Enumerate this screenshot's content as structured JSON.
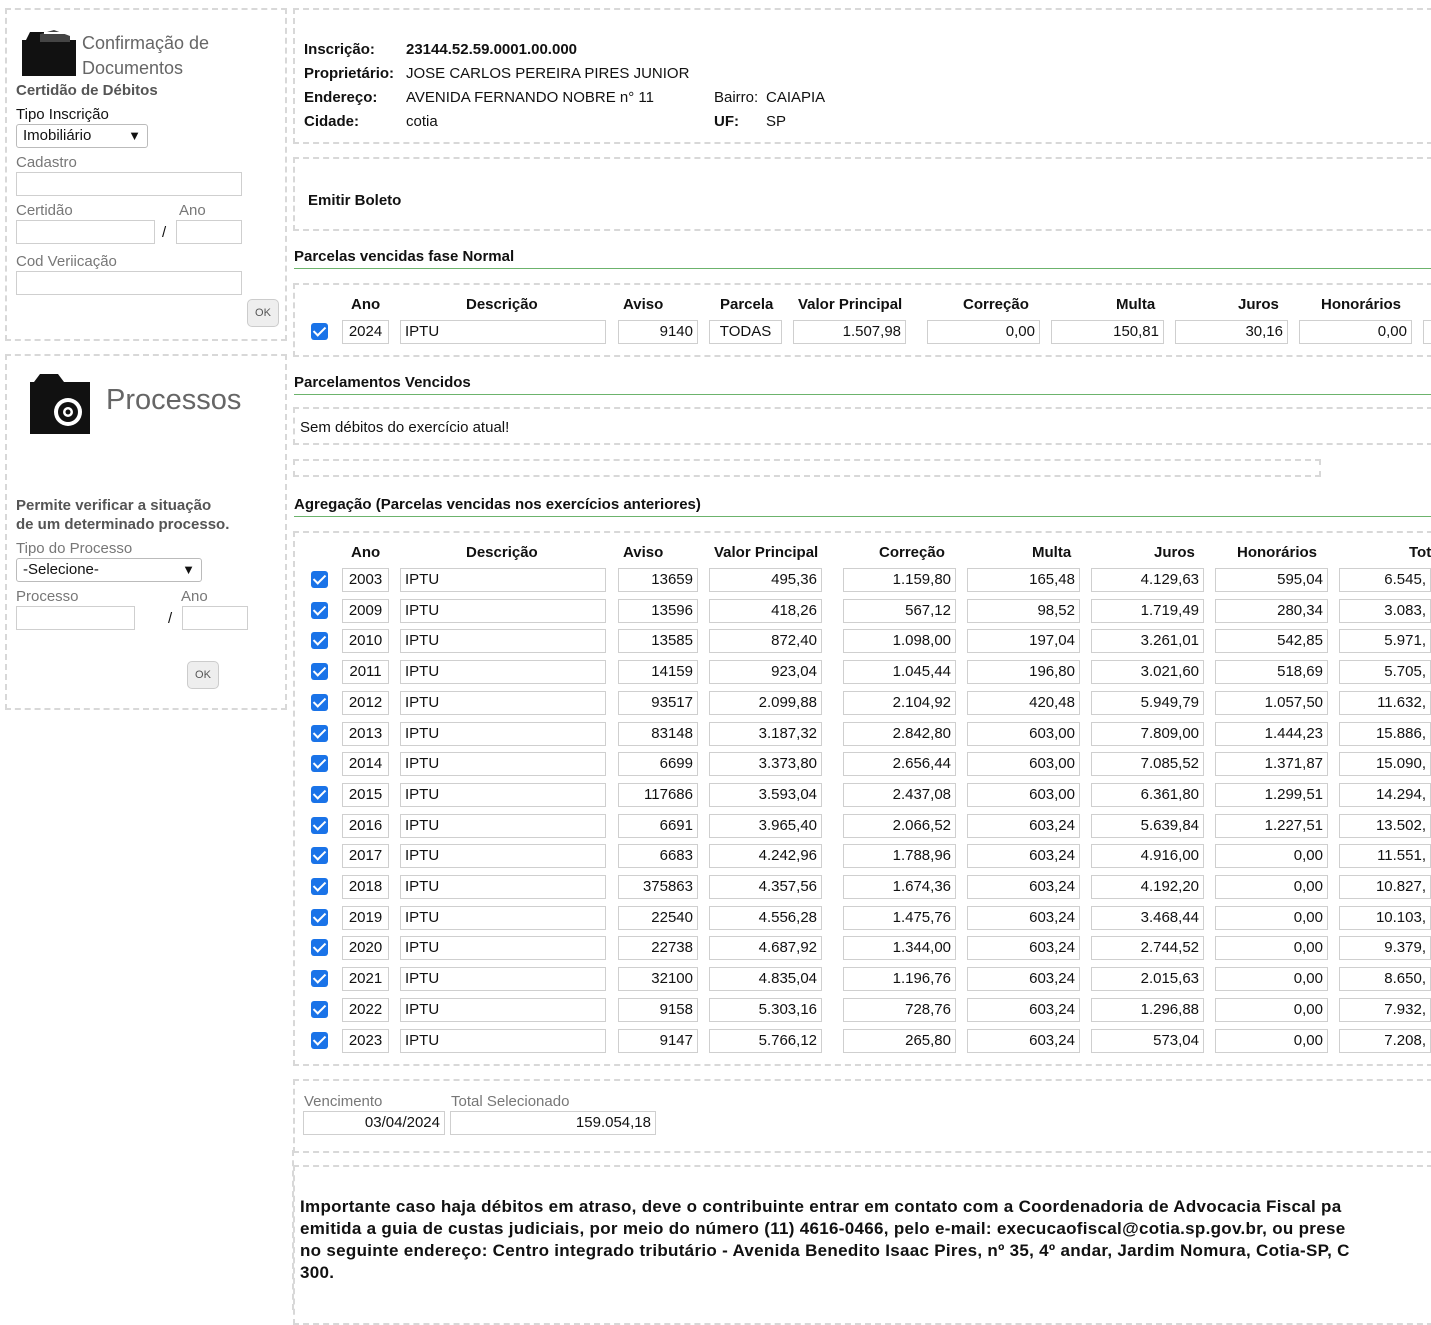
{
  "sidebar": {
    "confirm": {
      "logo_line1": "Confirmação de",
      "logo_line2": "Documentos",
      "section_title": "Certidão de Débitos",
      "tipo_label": "Tipo Inscrição",
      "tipo_value": "Imobiliário",
      "cadastro_label": "Cadastro",
      "certidao_label": "Certidão",
      "ano_label": "Ano",
      "slash": "/",
      "codver_label": "Cod Veriicação",
      "ok_label": "OK"
    },
    "processos": {
      "logo_text": "Processos",
      "desc_line1": "Permite verificar a situação",
      "desc_line2": "de um determinado processo.",
      "tipo_label": "Tipo do Processo",
      "tipo_value": "-Selecione-",
      "processo_label": "Processo",
      "ano_label": "Ano",
      "slash": "/",
      "ok_label": "OK"
    }
  },
  "owner": {
    "inscricao_label": "Inscrição:",
    "inscricao_value": "23144.52.59.0001.00.000",
    "proprietario_label": "Proprietário:",
    "proprietario_value": "JOSE CARLOS PEREIRA PIRES JUNIOR",
    "endereco_label": "Endereço:",
    "endereco_value": "AVENIDA FERNANDO NOBRE n° 11",
    "bairro_label": "Bairro:",
    "bairro_value": "CAIAPIA",
    "cidade_label": "Cidade:",
    "cidade_value": "cotia",
    "uf_label": "UF:",
    "uf_value": "SP"
  },
  "emitir_boleto": "Emitir Boleto",
  "normal": {
    "title": "Parcelas vencidas fase Normal",
    "headers": [
      "Ano",
      "Descrição",
      "Aviso",
      "Parcela",
      "Valor Principal",
      "Correção",
      "Multa",
      "Juros",
      "Honorários"
    ],
    "row": {
      "ano": "2024",
      "descricao": "IPTU",
      "aviso": "9140",
      "parcela": "TODAS",
      "principal": "1.507,98",
      "correcao": "0,00",
      "multa": "150,81",
      "juros": "30,16",
      "honorarios": "0,00"
    }
  },
  "parcelamentos": {
    "title": "Parcelamentos Vencidos",
    "message": "Sem débitos do exercício atual!"
  },
  "agregacao": {
    "title": "Agregação (Parcelas vencidas nos exercícios anteriores)",
    "headers": [
      "Ano",
      "Descrição",
      "Aviso",
      "Valor Principal",
      "Correção",
      "Multa",
      "Juros",
      "Honorários",
      "Tot"
    ],
    "rows": [
      {
        "ano": "2003",
        "descricao": "IPTU",
        "aviso": "13659",
        "principal": "495,36",
        "correcao": "1.159,80",
        "multa": "165,48",
        "juros": "4.129,63",
        "honorarios": "595,04",
        "total": "6.545,"
      },
      {
        "ano": "2009",
        "descricao": "IPTU",
        "aviso": "13596",
        "principal": "418,26",
        "correcao": "567,12",
        "multa": "98,52",
        "juros": "1.719,49",
        "honorarios": "280,34",
        "total": "3.083,"
      },
      {
        "ano": "2010",
        "descricao": "IPTU",
        "aviso": "13585",
        "principal": "872,40",
        "correcao": "1.098,00",
        "multa": "197,04",
        "juros": "3.261,01",
        "honorarios": "542,85",
        "total": "5.971,"
      },
      {
        "ano": "2011",
        "descricao": "IPTU",
        "aviso": "14159",
        "principal": "923,04",
        "correcao": "1.045,44",
        "multa": "196,80",
        "juros": "3.021,60",
        "honorarios": "518,69",
        "total": "5.705,"
      },
      {
        "ano": "2012",
        "descricao": "IPTU",
        "aviso": "93517",
        "principal": "2.099,88",
        "correcao": "2.104,92",
        "multa": "420,48",
        "juros": "5.949,79",
        "honorarios": "1.057,50",
        "total": "11.632,"
      },
      {
        "ano": "2013",
        "descricao": "IPTU",
        "aviso": "83148",
        "principal": "3.187,32",
        "correcao": "2.842,80",
        "multa": "603,00",
        "juros": "7.809,00",
        "honorarios": "1.444,23",
        "total": "15.886,"
      },
      {
        "ano": "2014",
        "descricao": "IPTU",
        "aviso": "6699",
        "principal": "3.373,80",
        "correcao": "2.656,44",
        "multa": "603,00",
        "juros": "7.085,52",
        "honorarios": "1.371,87",
        "total": "15.090,"
      },
      {
        "ano": "2015",
        "descricao": "IPTU",
        "aviso": "117686",
        "principal": "3.593,04",
        "correcao": "2.437,08",
        "multa": "603,00",
        "juros": "6.361,80",
        "honorarios": "1.299,51",
        "total": "14.294,"
      },
      {
        "ano": "2016",
        "descricao": "IPTU",
        "aviso": "6691",
        "principal": "3.965,40",
        "correcao": "2.066,52",
        "multa": "603,24",
        "juros": "5.639,84",
        "honorarios": "1.227,51",
        "total": "13.502,"
      },
      {
        "ano": "2017",
        "descricao": "IPTU",
        "aviso": "6683",
        "principal": "4.242,96",
        "correcao": "1.788,96",
        "multa": "603,24",
        "juros": "4.916,00",
        "honorarios": "0,00",
        "total": "11.551,"
      },
      {
        "ano": "2018",
        "descricao": "IPTU",
        "aviso": "375863",
        "principal": "4.357,56",
        "correcao": "1.674,36",
        "multa": "603,24",
        "juros": "4.192,20",
        "honorarios": "0,00",
        "total": "10.827,"
      },
      {
        "ano": "2019",
        "descricao": "IPTU",
        "aviso": "22540",
        "principal": "4.556,28",
        "correcao": "1.475,76",
        "multa": "603,24",
        "juros": "3.468,44",
        "honorarios": "0,00",
        "total": "10.103,"
      },
      {
        "ano": "2020",
        "descricao": "IPTU",
        "aviso": "22738",
        "principal": "4.687,92",
        "correcao": "1.344,00",
        "multa": "603,24",
        "juros": "2.744,52",
        "honorarios": "0,00",
        "total": "9.379,"
      },
      {
        "ano": "2021",
        "descricao": "IPTU",
        "aviso": "32100",
        "principal": "4.835,04",
        "correcao": "1.196,76",
        "multa": "603,24",
        "juros": "2.015,63",
        "honorarios": "0,00",
        "total": "8.650,"
      },
      {
        "ano": "2022",
        "descricao": "IPTU",
        "aviso": "9158",
        "principal": "5.303,16",
        "correcao": "728,76",
        "multa": "603,24",
        "juros": "1.296,88",
        "honorarios": "0,00",
        "total": "7.932,"
      },
      {
        "ano": "2023",
        "descricao": "IPTU",
        "aviso": "9147",
        "principal": "5.766,12",
        "correcao": "265,80",
        "multa": "603,24",
        "juros": "573,04",
        "honorarios": "0,00",
        "total": "7.208,"
      }
    ]
  },
  "totals": {
    "vencimento_label": "Vencimento",
    "vencimento_value": "03/04/2024",
    "total_label": "Total Selecionado",
    "total_value": "159.054,18"
  },
  "notice": {
    "line1": "Importante caso haja débitos em atraso, deve o contribuinte entrar em contato com a Coordenadoria de Advocacia Fiscal pa",
    "line2": "emitida a guia de custas judiciais, por meio do número (11) 4616-0466, pelo e-mail: execucaofiscal@cotia.sp.gov.br, ou prese",
    "line3": "no seguinte endereço: Centro integrado tributário - Avenida Benedito Isaac Pires, nº 35, 4º andar, Jardim Nomura, Cotia-SP, C",
    "line4": "300."
  },
  "colors": {
    "check": "#1a73e8",
    "section_line": "#6cb36c",
    "dashed_border": "#d8d8d8"
  }
}
